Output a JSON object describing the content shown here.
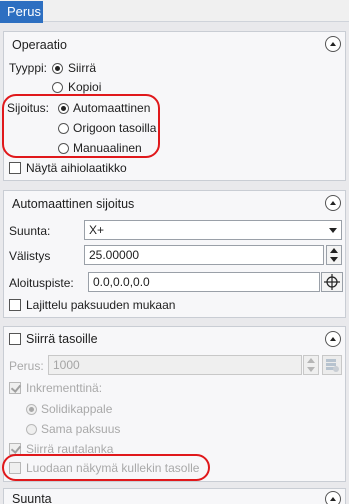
{
  "tab": {
    "label": "Perus"
  },
  "operation": {
    "title": "Operaatio",
    "type_label": "Tyyppi:",
    "type_options": [
      {
        "label": "Siirrä",
        "selected": true
      },
      {
        "label": "Kopioi",
        "selected": false
      }
    ],
    "placement_label": "Sijoitus:",
    "placement_options": [
      {
        "label": "Automaattinen",
        "selected": true
      },
      {
        "label": "Origoon tasoilla",
        "selected": false
      },
      {
        "label": "Manuaalinen",
        "selected": false
      }
    ],
    "show_dialog": {
      "label": "Näytä aihiolaatikko",
      "checked": false
    }
  },
  "auto_placement": {
    "title": "Automaattinen sijoitus",
    "direction_label": "Suunta:",
    "direction_value": "X+",
    "spacing_label": "Välistys",
    "spacing_value": "25.00000",
    "start_label": "Aloituspiste:",
    "start_value": "0.0,0.0,0.0",
    "sort": {
      "label": "Lajittelu paksuuden mukaan",
      "checked": false
    }
  },
  "move_to_layers": {
    "title": "Siirrä tasoille",
    "checked": false,
    "base_label": "Perus:",
    "base_value": "1000",
    "incremental": {
      "label": "Inkrementtinä:",
      "checked": true
    },
    "incremental_options": [
      {
        "label": "Solidikappale",
        "selected": true
      },
      {
        "label": "Sama paksuus",
        "selected": false
      }
    ],
    "move_wireframe": {
      "label": "Siirrä rautalanka",
      "checked": true
    },
    "create_view": {
      "label": "Luodaan näkymä kullekin tasolle",
      "checked": false
    }
  },
  "direction_panel": {
    "title": "Suunta"
  },
  "colors": {
    "tab_bg": "#2d6fc1",
    "highlight": "#e0181b"
  }
}
